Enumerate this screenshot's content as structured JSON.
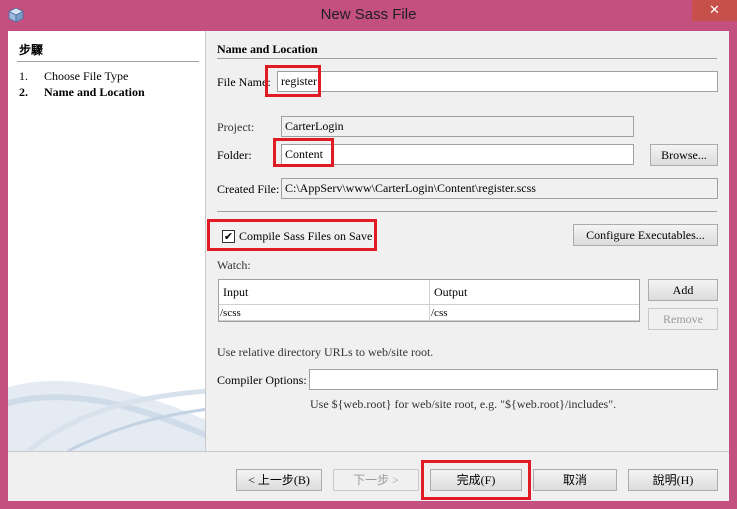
{
  "window": {
    "title": "New Sass File",
    "close_label": "✕",
    "app_icon": "netbeans-cube-icon"
  },
  "steps": {
    "title": "步驟",
    "items": [
      {
        "num": "1.",
        "label": "Choose File Type"
      },
      {
        "num": "2.",
        "label": "Name and Location"
      }
    ]
  },
  "form": {
    "section_title": "Name and Location",
    "file_name_label": "File Name:",
    "file_name_value": "register",
    "project_label": "Project:",
    "project_value": "CarterLogin",
    "folder_label": "Folder:",
    "folder_value": "Content",
    "browse_label": "Browse...",
    "created_file_label": "Created File:",
    "created_file_value": "C:\\AppServ\\www\\CarterLogin\\Content\\register.scss",
    "compile_label": "Compile Sass Files on Save",
    "compile_checked": true,
    "configure_label": "Configure Executables...",
    "watch_label": "Watch:",
    "watch_table": {
      "headers": [
        "Input",
        "Output"
      ],
      "rows": [
        [
          "/scss",
          "/css"
        ]
      ]
    },
    "add_label": "Add",
    "remove_label": "Remove",
    "relative_hint": "Use relative directory URLs to web/site root.",
    "compiler_options_label": "Compiler Options:",
    "compiler_options_value": "",
    "compiler_hint": "Use ${web.root} for web/site root, e.g. \"${web.root}/includes\"."
  },
  "footer": {
    "back_label": "< 上一步(B)",
    "next_label": "下一步 >",
    "finish_label": "完成(F)",
    "cancel_label": "取消",
    "help_label": "說明(H)"
  },
  "colors": {
    "titlebar": "#c4507f",
    "highlight": "#e01b24",
    "close_button": "#c7504b"
  }
}
